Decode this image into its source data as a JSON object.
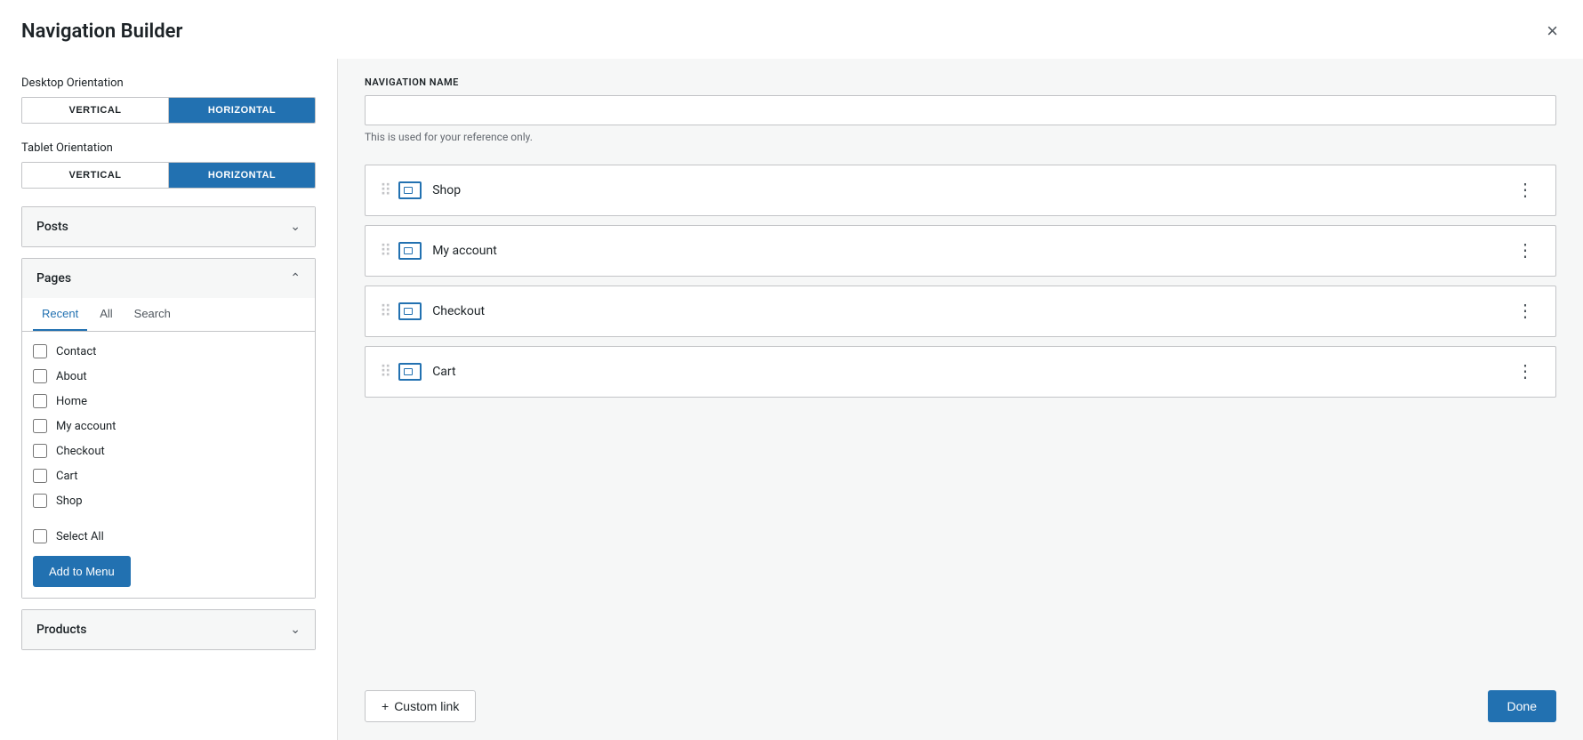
{
  "modal": {
    "title": "Navigation Builder",
    "close_label": "×"
  },
  "desktop_orientation": {
    "label": "Desktop Orientation",
    "buttons": [
      {
        "label": "VERTICAL",
        "active": false
      },
      {
        "label": "HORIZONTAL",
        "active": true
      }
    ]
  },
  "tablet_orientation": {
    "label": "Tablet Orientation",
    "buttons": [
      {
        "label": "VERTICAL",
        "active": false
      },
      {
        "label": "HORIZONTAL",
        "active": true
      }
    ]
  },
  "posts_accordion": {
    "title": "Posts",
    "expanded": false
  },
  "pages_accordion": {
    "title": "Pages",
    "expanded": true,
    "tabs": [
      {
        "label": "Recent",
        "active": true
      },
      {
        "label": "All",
        "active": false
      },
      {
        "label": "Search",
        "active": false
      }
    ],
    "items": [
      {
        "label": "Contact"
      },
      {
        "label": "About"
      },
      {
        "label": "Home"
      },
      {
        "label": "My account"
      },
      {
        "label": "Checkout"
      },
      {
        "label": "Cart"
      },
      {
        "label": "Shop"
      }
    ],
    "select_all_label": "Select All",
    "add_to_menu_label": "Add to Menu"
  },
  "products_accordion": {
    "title": "Products",
    "expanded": false
  },
  "nav_name": {
    "label": "NAVIGATION NAME",
    "placeholder": "",
    "hint": "This is used for your reference only."
  },
  "menu_items": [
    {
      "label": "Shop"
    },
    {
      "label": "My account"
    },
    {
      "label": "Checkout"
    },
    {
      "label": "Cart"
    }
  ],
  "footer": {
    "custom_link_label": "Custom link",
    "done_label": "Done"
  }
}
